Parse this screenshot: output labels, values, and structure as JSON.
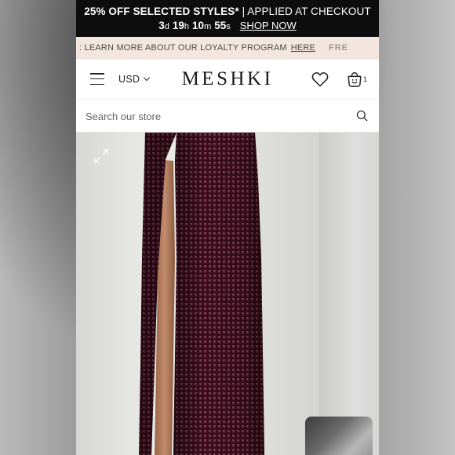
{
  "promo": {
    "headline_bold": "25% OFF SELECTED STYLES*",
    "headline_rest": " | APPLIED AT CHECKOUT",
    "countdown": {
      "days": "3",
      "days_unit": "d",
      "hours": "19",
      "hours_unit": "h",
      "minutes": "10",
      "minutes_unit": "m",
      "seconds": "55",
      "seconds_unit": "s"
    },
    "shop_now": "SHOP NOW"
  },
  "loyalty": {
    "text": ": LEARN MORE ABOUT OUR LOYALTY PROGRAM",
    "link": "HERE",
    "next_text": "FRE"
  },
  "nav": {
    "currency": "USD",
    "logo": "MESHKI",
    "cart_count": "1"
  },
  "search": {
    "placeholder": "Search our store"
  },
  "colors": {
    "promo_bg": "#0d0d0d",
    "loyalty_bg": "#f2e6df",
    "skirt": "#3b0d1d"
  },
  "icons": [
    "hamburger-icon",
    "chevron-down-icon",
    "heart-icon",
    "shopping-bag-icon",
    "search-icon",
    "expand-icon"
  ]
}
